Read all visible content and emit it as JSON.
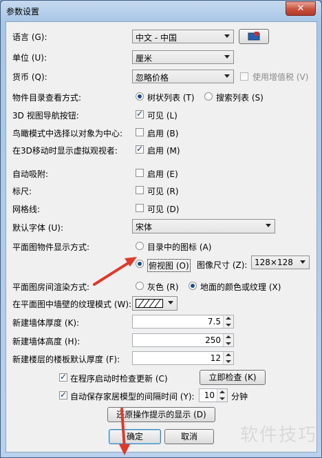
{
  "window": {
    "title": "参数设置",
    "close_glyph": "✕"
  },
  "rows": {
    "language": {
      "label": "语言 (G):",
      "value": "中文 - 中国"
    },
    "unit": {
      "label": "单位 (U):",
      "value": "厘米"
    },
    "currency": {
      "label": "货币 (Q):",
      "value": "忽略价格",
      "vat_label": "使用增值税 (V)"
    },
    "catalog_view": {
      "label": "物件目录查看方式:",
      "option1": "树状列表 (T)",
      "option2": "搜索列表 (S)"
    },
    "nav_3d": {
      "label": "3D 视图导航按钮:",
      "check_label": "可见 (L)"
    },
    "aerial_select": {
      "label": "鸟瞰模式中选择以对象为中心:",
      "check_label": "启用 (B)"
    },
    "virtual_visitor": {
      "label": "在3D移动时显示虚拟观视者:",
      "check_label": "启用 (M)"
    },
    "magnetism": {
      "label": "自动吸附:",
      "check_label": "启用 (E)"
    },
    "rulers": {
      "label": "标尺:",
      "check_label": "可见 (R)"
    },
    "grid": {
      "label": "网格线:",
      "check_label": "可见 (D)"
    },
    "default_font": {
      "label": "默认字体 (U):",
      "value": "宋体"
    },
    "plan_furniture": {
      "label": "平面图物件显示方式:",
      "option1": "目录中的图标 (A)",
      "option2": "俯视图 (O)",
      "image_size_label": "图像尺寸 (Z):",
      "image_size_value": "128×128"
    },
    "room_render": {
      "label": "平面图房间渲染方式:",
      "option1": "灰色 (R)",
      "option2": "地面的颜色或纹理 (X)"
    },
    "wall_pattern": {
      "label": "在平面图中墙壁的纹理模式 (W):"
    },
    "wall_thickness": {
      "label": "新建墙体厚度 (K):",
      "value": "7.5"
    },
    "wall_height": {
      "label": "新建墙体高度 (H):",
      "value": "250"
    },
    "floor_thickness": {
      "label": "新建楼层的楼板默认厚度 (F):",
      "value": "12"
    }
  },
  "updates": {
    "label": "在程序启动时检查更新 (C)",
    "button": "立即检查 (K)"
  },
  "autosave": {
    "label": "自动保存家居模型的间隔时间 (Y):",
    "value": "10",
    "unit": "分钟"
  },
  "buttons": {
    "restore": "还原操作提示的显示 (D)",
    "ok": "确定",
    "cancel": "取消"
  },
  "watermark": "软件技巧",
  "colors": {
    "arrow": "#e0392b"
  }
}
